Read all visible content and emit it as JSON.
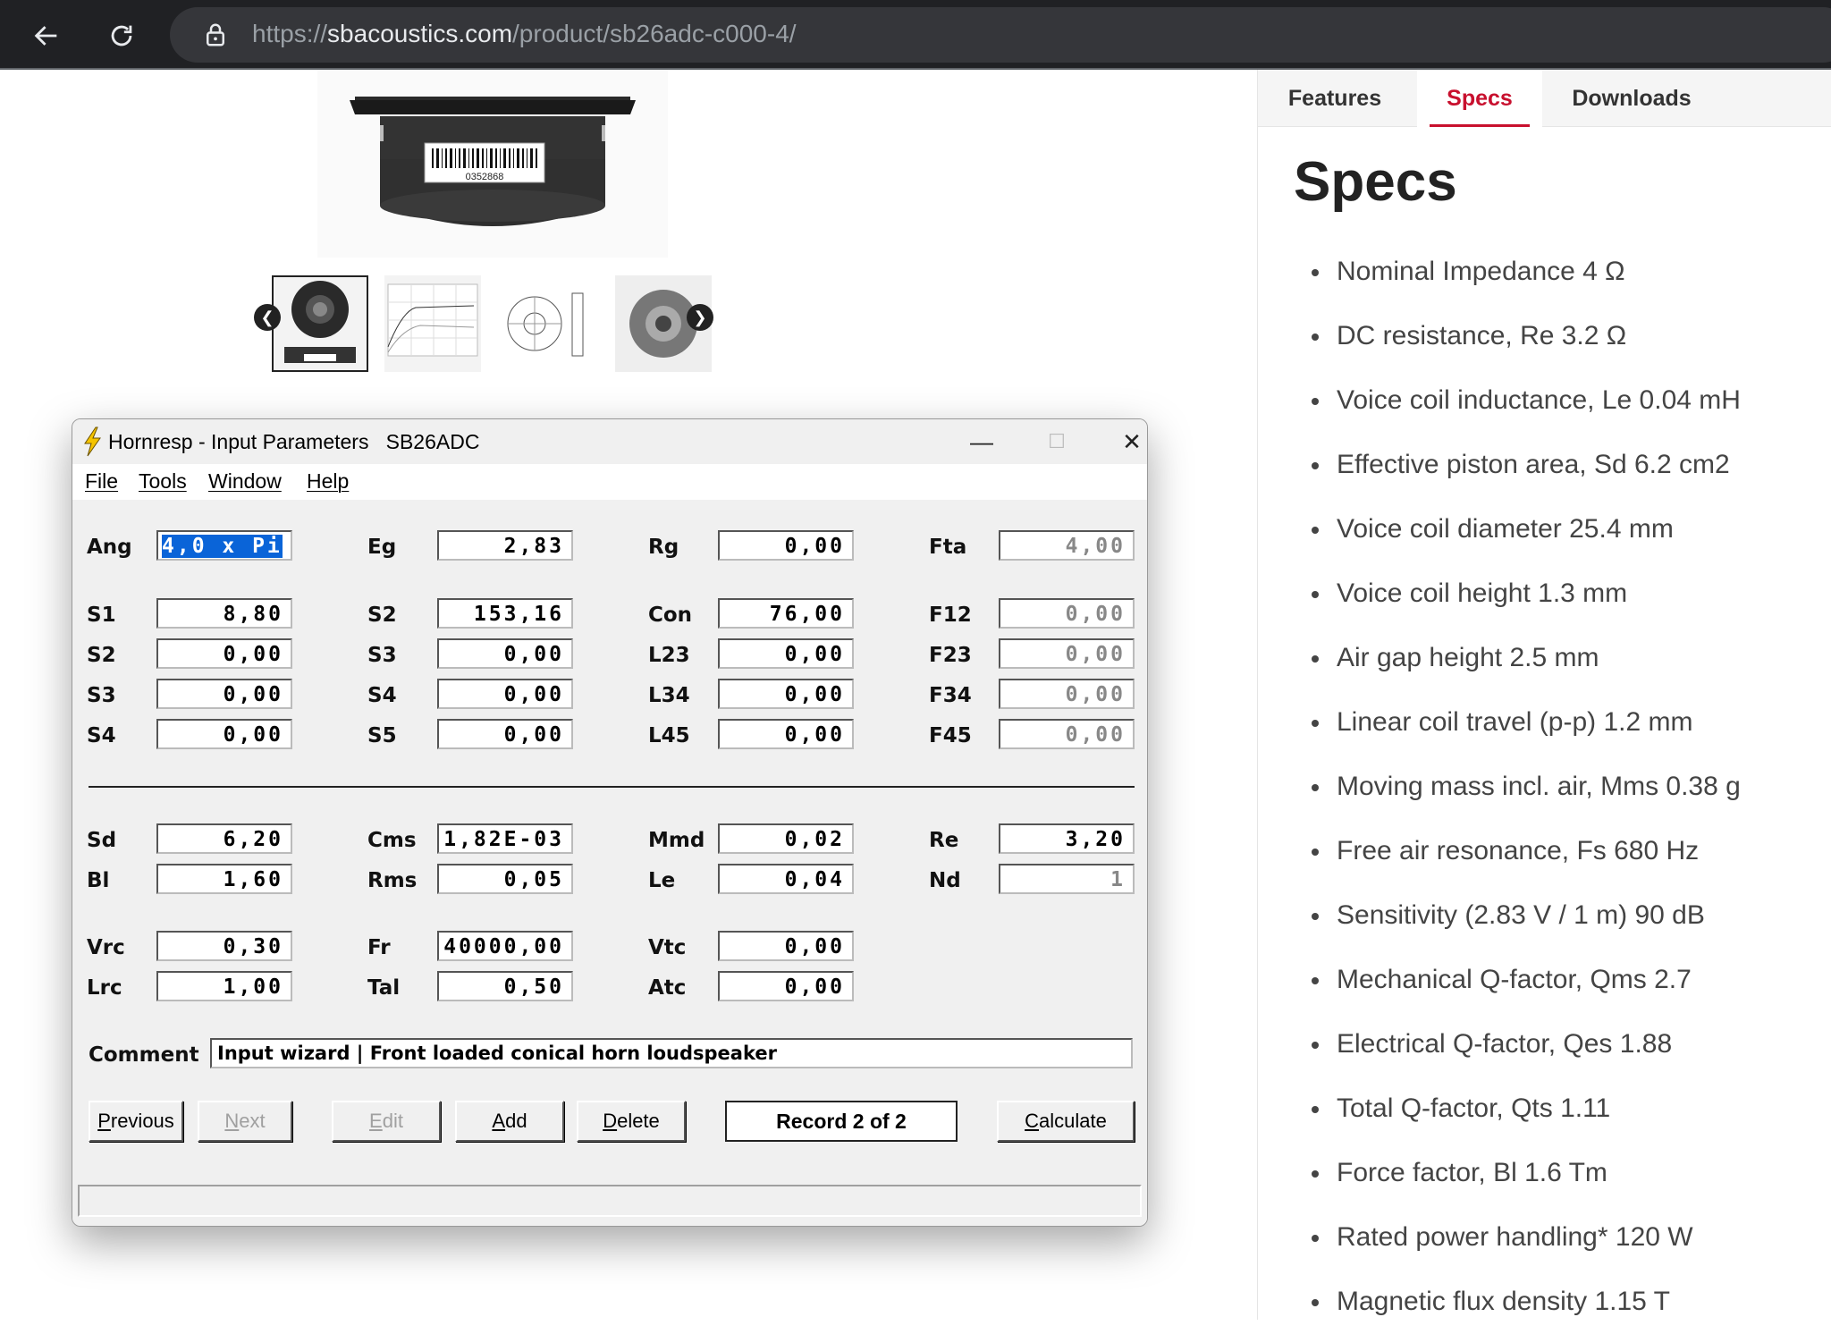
{
  "browser": {
    "url_scheme": "https://",
    "url_host": "sbacoustics.com",
    "url_path": "/product/sb26adc-c000-4/"
  },
  "product": {
    "barcode_number": "0352868"
  },
  "tabs": [
    {
      "label": "Features",
      "active": false
    },
    {
      "label": "Specs",
      "active": true
    },
    {
      "label": "Downloads",
      "active": false
    }
  ],
  "specs": {
    "title": "Specs",
    "items": [
      "Nominal Impedance 4 Ω",
      "DC resistance, Re 3.2 Ω",
      "Voice coil inductance, Le 0.04 mH",
      "Effective piston area, Sd 6.2 cm2",
      "Voice coil diameter 25.4 mm",
      "Voice coil height 1.3 mm",
      "Air gap height 2.5 mm",
      "Linear coil travel (p-p) 1.2 mm",
      "Moving mass incl. air, Mms 0.38 g",
      "Free air resonance, Fs 680 Hz",
      "Sensitivity (2.83 V / 1 m) 90 dB",
      "Mechanical Q-factor, Qms 2.7",
      "Electrical Q-factor, Qes 1.88",
      "Total Q-factor, Qts 1.11",
      "Force factor, Bl 1.6 Tm",
      "Rated power handling* 120 W",
      "Magnetic flux density 1.15 T"
    ]
  },
  "hornresp": {
    "title": "Hornresp - Input Parameters   SB26ADC",
    "menu": [
      "File",
      "Tools",
      "Window",
      "Help"
    ],
    "params": {
      "Ang": "4,0 x Pi",
      "Eg": "2,83",
      "Rg": "0,00",
      "Fta": "4,00",
      "S1": "8,80",
      "S2a": "153,16",
      "Con": "76,00",
      "F12": "0,00",
      "S2": "0,00",
      "S3a": "0,00",
      "L23": "0,00",
      "F23": "0,00",
      "S3": "0,00",
      "S4a": "0,00",
      "L34": "0,00",
      "F34": "0,00",
      "S4": "0,00",
      "S5": "0,00",
      "L45": "0,00",
      "F45": "0,00",
      "Sd": "6,20",
      "Cms": "1,82E-03",
      "Mmd": "0,02",
      "Re": "3,20",
      "Bl": "1,60",
      "Rms": "0,05",
      "Le": "0,04",
      "Nd": "1",
      "Vrc": "0,30",
      "Fr": "40000,00",
      "Vtc": "0,00",
      "Lrc": "1,00",
      "Tal": "0,50",
      "Atc": "0,00"
    },
    "labels": {
      "Ang": "Ang",
      "Eg": "Eg",
      "Rg": "Rg",
      "Fta": "Fta",
      "S1": "S1",
      "S2a": "S2",
      "Con": "Con",
      "F12": "F12",
      "S2": "S2",
      "S3a": "S3",
      "L23": "L23",
      "F23": "F23",
      "S3": "S3",
      "S4a": "S4",
      "L34": "L34",
      "F34": "F34",
      "S4": "S4",
      "S5": "S5",
      "L45": "L45",
      "F45": "F45",
      "Sd": "Sd",
      "Cms": "Cms",
      "Mmd": "Mmd",
      "Re": "Re",
      "Bl": "Bl",
      "Rms": "Rms",
      "Le": "Le",
      "Nd": "Nd",
      "Vrc": "Vrc",
      "Fr": "Fr",
      "Vtc": "Vtc",
      "Lrc": "Lrc",
      "Tal": "Tal",
      "Atc": "Atc",
      "Comment": "Comment"
    },
    "comment": "Input wizard | Front loaded conical horn loudspeaker",
    "buttons": {
      "previous_rest": "revious",
      "previous_key": "P",
      "next_rest": "ext",
      "next_key": "N",
      "edit_rest": "dit",
      "edit_key": "E",
      "add_rest": "dd",
      "add_key": "A",
      "delete_rest": "elete",
      "delete_key": "D",
      "calculate_rest": "alculate",
      "calculate_key": "C"
    },
    "record": "Record 2 of 2"
  }
}
